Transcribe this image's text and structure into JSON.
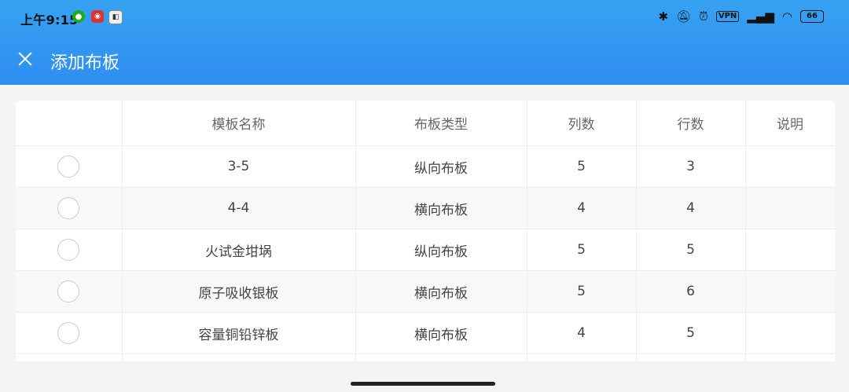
{
  "status": {
    "time": "上午9:15",
    "vpn": "VPN",
    "battery": "66"
  },
  "header": {
    "title": "添加布板"
  },
  "table": {
    "columns": [
      "",
      "模板名称",
      "布板类型",
      "列数",
      "行数",
      "说明"
    ],
    "rows": [
      {
        "name": "3-5",
        "type": "纵向布板",
        "cols": "5",
        "rows": "3",
        "desc": ""
      },
      {
        "name": "4-4",
        "type": "横向布板",
        "cols": "4",
        "rows": "4",
        "desc": ""
      },
      {
        "name": "火试金坩埚",
        "type": "纵向布板",
        "cols": "5",
        "rows": "5",
        "desc": ""
      },
      {
        "name": "原子吸收银板",
        "type": "横向布板",
        "cols": "5",
        "rows": "6",
        "desc": ""
      },
      {
        "name": "容量铜铅锌板",
        "type": "横向布板",
        "cols": "4",
        "rows": "5",
        "desc": ""
      }
    ]
  },
  "colors": {
    "header_top": "#36a2f1",
    "header_bottom": "#2f8ef0",
    "row_alt": "#f7f8fa"
  }
}
